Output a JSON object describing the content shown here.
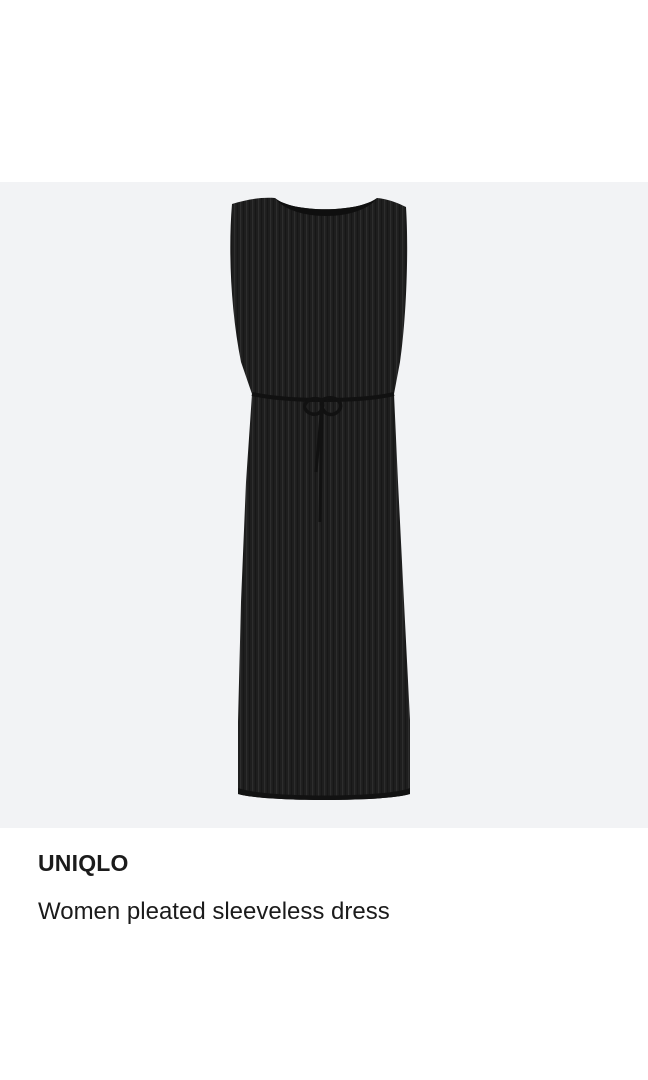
{
  "product": {
    "brand": "UNIQLO",
    "title": "Women pleated sleeveless dress",
    "image": {
      "icon": "dress-image",
      "garment_color": "#1c1c1c",
      "background_color": "#f2f3f5"
    }
  }
}
